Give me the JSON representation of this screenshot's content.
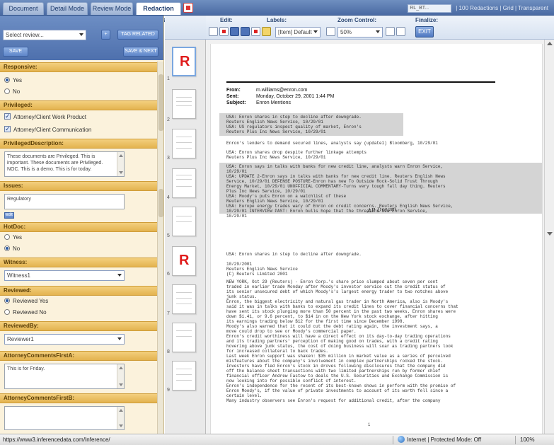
{
  "tabs": [
    {
      "label": "Document"
    },
    {
      "label": "Detail Mode"
    },
    {
      "label": "Review Mode"
    },
    {
      "label": "Redaction Mode"
    }
  ],
  "topbar": {
    "right_select": "RL_BT...",
    "right_links": "| 100 Redactions | Grid | Transparent"
  },
  "left": {
    "select_review": "Select review...",
    "add_label": "+",
    "tag_related": "TAG RELATED",
    "save": "SAVE",
    "save_next": "SAVE & NEXT",
    "responsive": {
      "title": "Responsive:",
      "yes": "Yes",
      "no": "No"
    },
    "privileged": {
      "title": "Privileged:",
      "opt1": "Attorney/Client Work Product",
      "opt2": "Attorney/Client Communication"
    },
    "priv_desc": {
      "title": "PrivilegedDescription:",
      "text": "These documents are Privileged. This is important. These documents are Privileged. NOC. This is a demo. This is for today."
    },
    "issues": {
      "title": "Issues:",
      "text": "Regulatory",
      "edit": "edit"
    },
    "hotdoc": {
      "title": "HotDoc:",
      "yes": "Yes",
      "no": "No"
    },
    "witness": {
      "title": "Witness:",
      "value": "Witness1"
    },
    "reviewed": {
      "title": "Reviewed:",
      "yes": "Reviewed Yes",
      "no": "Reviewed No"
    },
    "reviewed_by": {
      "title": "ReviewedBy:",
      "value": "Reviewer1"
    },
    "comments1": {
      "title": "AttorneyCommentsFirstA:",
      "text": "This is for Friday."
    },
    "comments2": {
      "title": "AttorneyCommentsFirstB:",
      "text": ""
    }
  },
  "thumbs": {
    "pages": [
      "1",
      "2",
      "3",
      "4",
      "5",
      "6",
      "7",
      "8",
      "9"
    ],
    "redacted_mark": "R"
  },
  "toolbar": {
    "edit": "Edit:",
    "labels": "Labels:",
    "zoom_control": "Zoom Control:",
    "finalize": "Finalize:",
    "label_select": "[Item] Default",
    "zoom_value": "50%",
    "exit": "EXIT"
  },
  "document": {
    "from_label": "From:",
    "from_value": "m.williams@enron.com",
    "sent_label": "Sent:",
    "sent_value": "Monday, October 29, 2001 1:44 PM",
    "subject_label": "Subject:",
    "subject_value": "Enron Mentions",
    "block1": "USA: Enron shares in step to decline after downgrade.\nReuters English News Service, 10/29/01\nUSA: US regulators inspect quality of market, Enron's\nReuters Plus Inc News Service, 10/29/01",
    "line2": "Enron's lenders to demand secured lines, analysts say (update1) Bloomberg, 10/29/01",
    "block3": "USA: Enron shares drop despite further linkage attempts\nReuters Plus Inc News Service, 10/29/01",
    "block4": "USA: Enron says in talks with banks for new credit line, analysts warn Enron Service,\n10/29/01\nUSA: UPDATE 2-Enron says in talks with banks for new credit line. Reuters English News\nService, 10/29/01 DEFENSE POSTURE-Enron has new To Outside Rock-Solid Trust Through\nEnergy Market, 10/29/01 UNOFFICIAL COMMENTARY-Turns very tough fall day thing. Reuters\nPlus Inc News Service, 10/29/01\nUSA: Moody's puts Enron on a watchlist of these\nReuters English News Service, 10/29/01\nUSA: Europe energy trades wary of Enron on credit concerns. Reuters English News Service,\n10/29/01 INTERVIEW PAST: Enron bulls hope that the threatens New Enron Service,\n10/29/01",
    "stamp": "AP Dream",
    "block5": "USA: Enron shares in step to decline after downgrade.",
    "block6": "10/29/2001\nReuters English News Service\n(C) Reuters Limited 2001",
    "block7": "NEW YORK, Oct 29 (Reuters) - Enron Corp.'s share price slumped about seven per cent\ntraded in earlier trade Monday after Moody's investor service cut the credit status of\nits senior unsecured debt of which Moody's's largest energy trader to two notches above\njunk status.\nEnron, the biggest electricity and natural gas trader in North America, also is Moody's\nsaid it was in talks with banks to expand its credit lines to cover financial concerns that\nhave sent its stock plunging more than 50 percent in the past two weeks. Enron shares were\ndown $1.41, or 9.6 percent, to $14 in on the New York stock exchange, after hitting\nits earnings trading below $12 for the first time since December 1998.\nMoody's also warned that it could cut the debt rating again, the investment says, a\nmove could drop to see or Moody's commercial paper.\nEnron's credit worthiness will have a direct effect on its day-to-day trading operations\nand its trading partners' perception of making good on trades, with a credit rating\nhovering above junk status, the cost of doing business will soar as trading partners look\nfor increased collateral to back trades.\nLast week Enron support was shaken: $35 million in market value as a series of perceived\nmisfeatures about the company's involvement in complex partnerships rocked the stock.\nInvestors have fled Enron's stock in droves following disclosures that the company did\noff the balance sheet transactions with two limited partnerships run by former chief\nfinancial officer Andrew Fastow to deals the U.S. Securities and Exchange Commission is\nnow looking into for possible conflict of interest.\nEnron's independence for the recent of its best-known shows in perform with the promise of\nEnron Moody's, if the value of private investments to account of its worth fell since a\ncertain level.\nMany industry observers see Enron's request for additional credit, after the company",
    "page_end": "1"
  },
  "status": {
    "url": "https://www3.inferencedata.com/Inference/",
    "zone": "Internet | Protected Mode: Off",
    "zoom": "100%"
  }
}
